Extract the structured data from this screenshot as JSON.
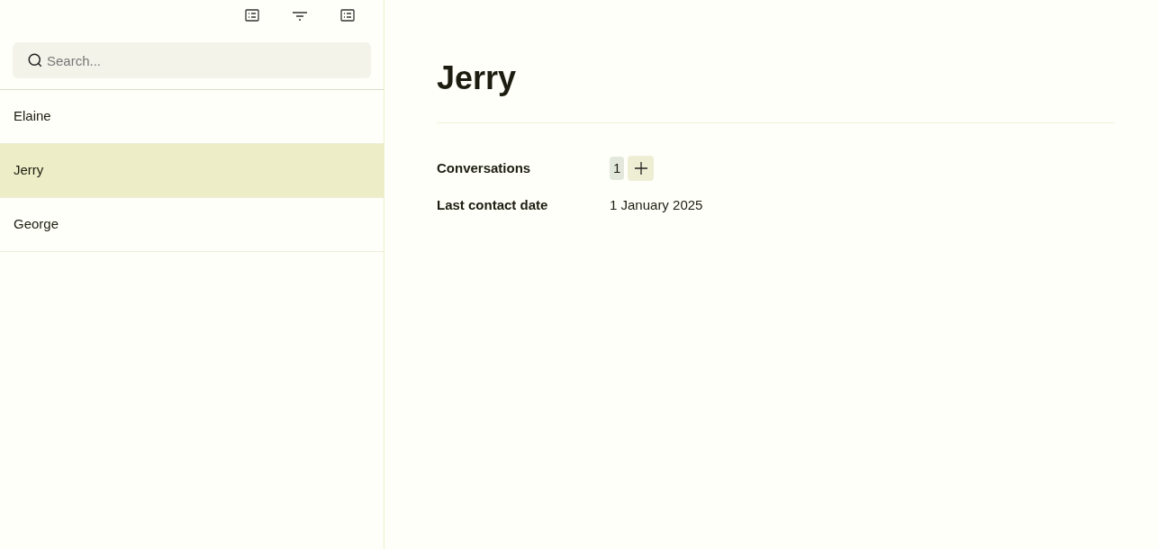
{
  "search": {
    "placeholder": "Search..."
  },
  "contacts": [
    {
      "name": "Elaine",
      "selected": false
    },
    {
      "name": "Jerry",
      "selected": true
    },
    {
      "name": "George",
      "selected": false
    }
  ],
  "detail": {
    "title": "Jerry",
    "fields": [
      {
        "kind": "count",
        "label": "Conversations",
        "value": "1"
      },
      {
        "kind": "text",
        "label": "Last contact date",
        "value": "1 January 2025"
      }
    ]
  }
}
